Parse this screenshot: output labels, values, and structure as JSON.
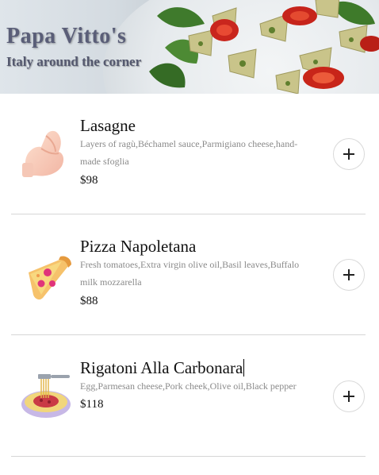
{
  "header": {
    "title": "Papa Vitto's",
    "tagline": "Italy around the corner"
  },
  "menu": {
    "items": [
      {
        "name": "Lasagne",
        "description": "Layers of ragù,Béchamel sauce,Parmigiano cheese,hand-made sfoglia",
        "price": "$98",
        "icon": "pinched-fingers-icon"
      },
      {
        "name": "Pizza Napoletana",
        "description": "Fresh tomatoes,Extra virgin olive oil,Basil leaves,Buffalo milk mozzarella",
        "price": "$88",
        "icon": "pizza-icon"
      },
      {
        "name": "Rigatoni Alla Carbonara",
        "description": "Egg,Parmesan cheese,Pork cheek,Olive oil,Black pepper",
        "price": "$118",
        "icon": "spaghetti-icon"
      }
    ],
    "add_icon": "plus-icon"
  },
  "colors": {
    "title": "#5a5e78",
    "description": "#8a8a8a",
    "divider": "#d6d6d6"
  }
}
